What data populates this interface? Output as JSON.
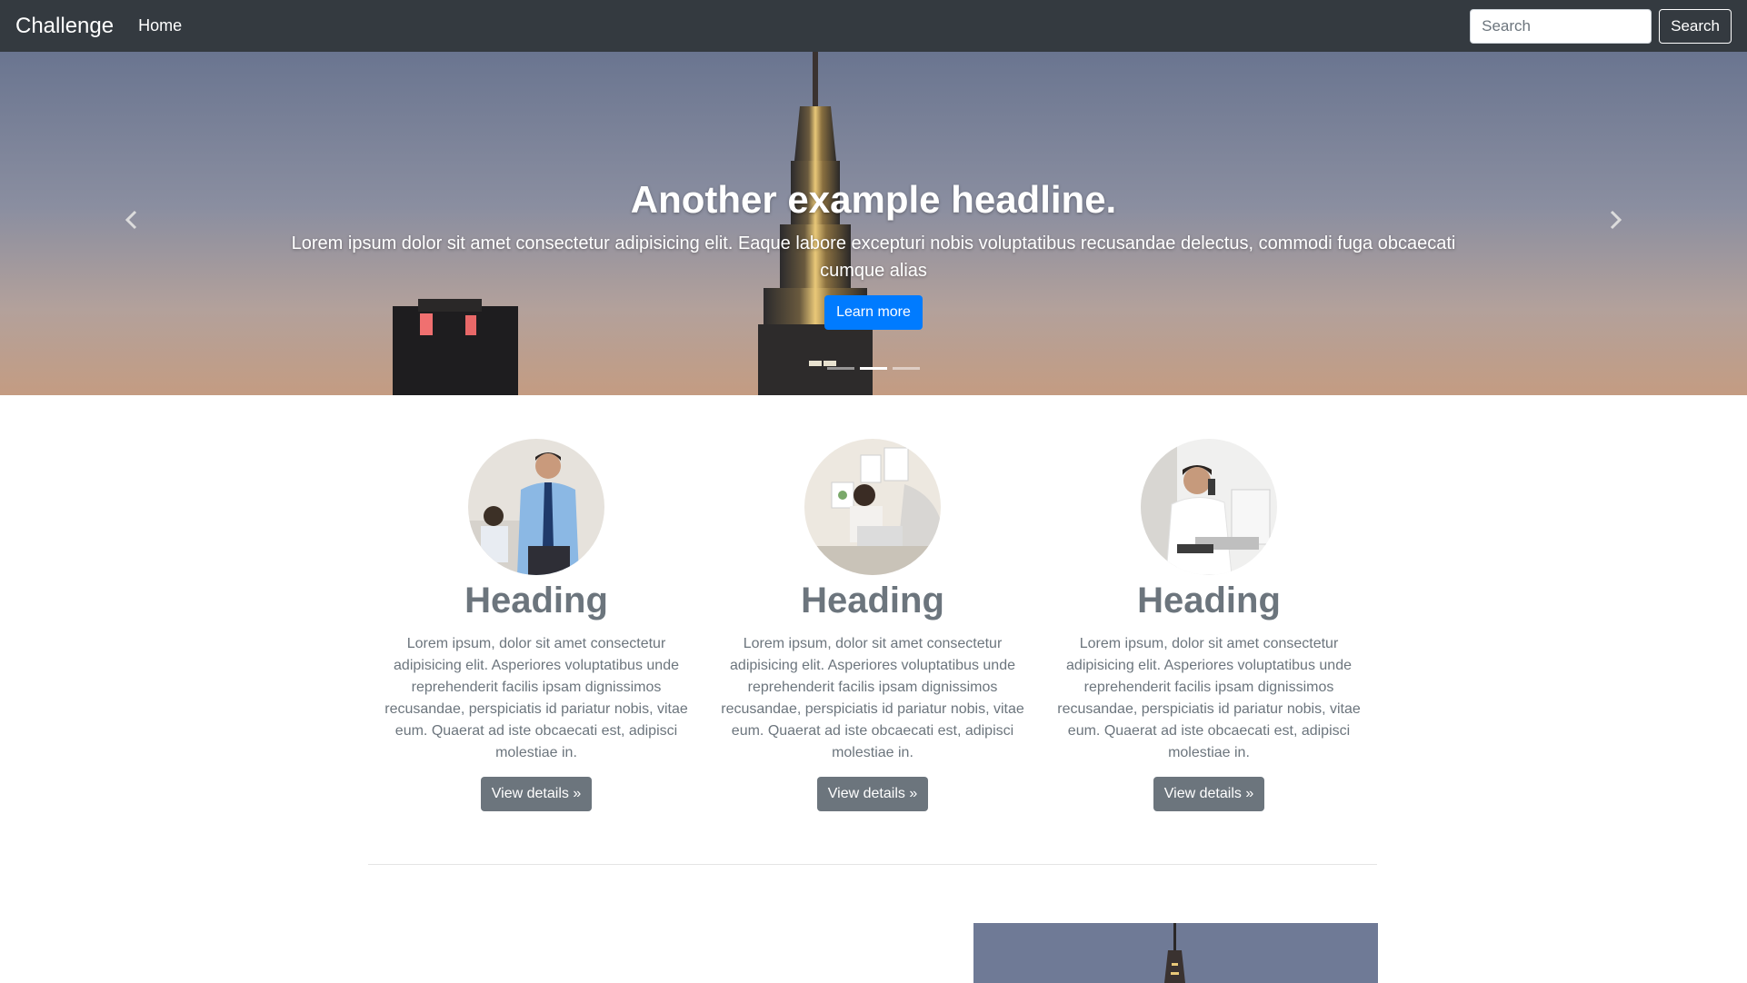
{
  "navbar": {
    "brand": "Challenge",
    "links": [
      {
        "label": "Home"
      }
    ],
    "search": {
      "placeholder": "Search",
      "button_label": "Search"
    }
  },
  "carousel": {
    "headline": "Another example headline.",
    "text": "Lorem ipsum dolor sit amet consectetur adipisicing elit. Eaque labore excepturi nobis voluptatibus recusandae delectus, commodi fuga obcaecati cumque alias",
    "button_label": "Learn more",
    "slide_count": 3,
    "active_slide": 2
  },
  "marketing": {
    "columns": [
      {
        "heading": "Heading",
        "text": "Lorem ipsum, dolor sit amet consectetur adipisicing elit. Asperiores voluptatibus unde reprehenderit facilis ipsam dignissimos recusandae, perspiciatis id pariatur nobis, vitae eum. Quaerat ad iste obcaecati est, adipisci molestiae in.",
        "button_label": "View details »"
      },
      {
        "heading": "Heading",
        "text": "Lorem ipsum, dolor sit amet consectetur adipisicing elit. Asperiores voluptatibus unde reprehenderit facilis ipsam dignissimos recusandae, perspiciatis id pariatur nobis, vitae eum. Quaerat ad iste obcaecati est, adipisci molestiae in.",
        "button_label": "View details »"
      },
      {
        "heading": "Heading",
        "text": "Lorem ipsum, dolor sit amet consectetur adipisicing elit. Asperiores voluptatibus unde reprehenderit facilis ipsam dignissimos recusandae, perspiciatis id pariatur nobis, vitae eum. Quaerat ad iste obcaecati est, adipisci molestiae in.",
        "button_label": "View details »"
      }
    ]
  },
  "colors": {
    "navbar_bg": "#343a40",
    "primary": "#007bff",
    "secondary": "#6c757d",
    "muted_text": "#6c757d"
  },
  "icons": {
    "prev": "chevron-left-icon",
    "next": "chevron-right-icon"
  }
}
